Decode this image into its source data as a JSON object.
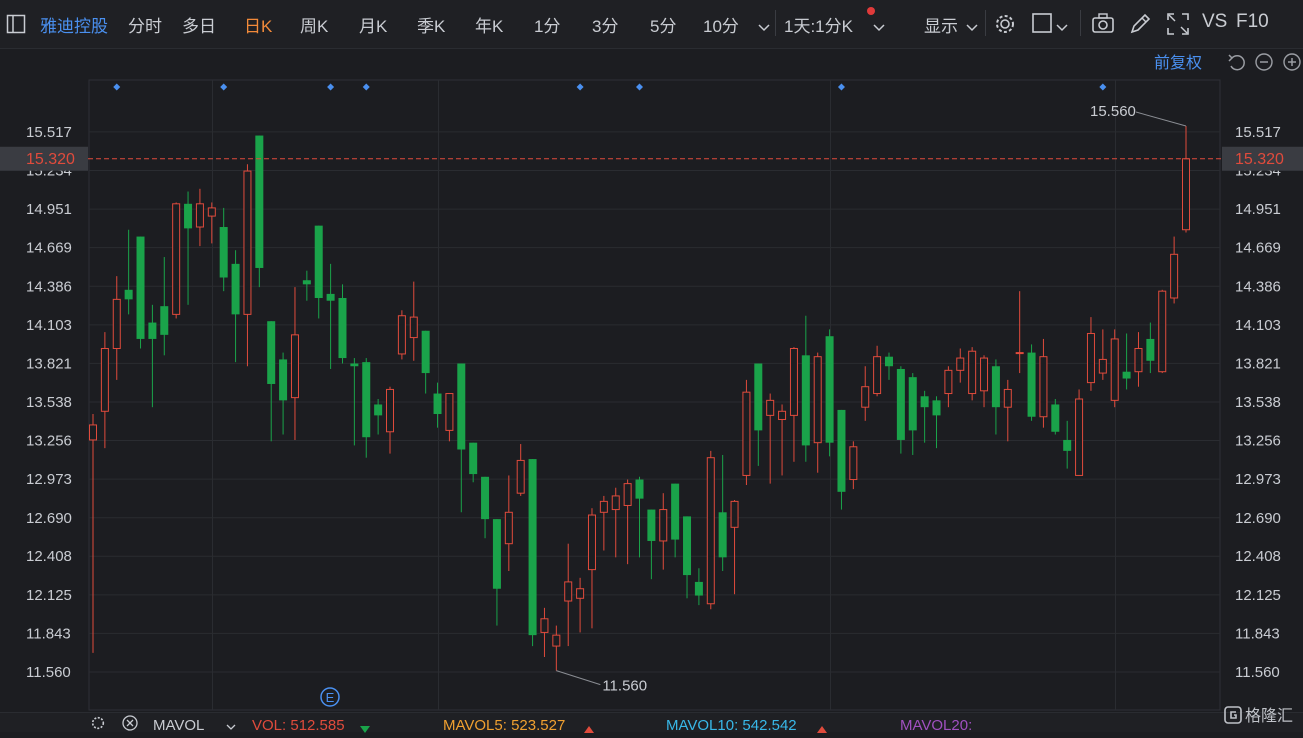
{
  "toolbar": {
    "stock_name": "雅迪控股",
    "periods": [
      "分时",
      "多日",
      "日K",
      "周K",
      "月K",
      "季K",
      "年K",
      "1分",
      "3分",
      "5分",
      "10分"
    ],
    "active_period": "日K",
    "multi_period": "1天:1分K",
    "display_label": "显示",
    "vs_label": "VS",
    "f10_label": "F10"
  },
  "chart_header": {
    "adjust_label": "前复权"
  },
  "price_axis": {
    "ticks": [
      "15.517",
      "15.234",
      "14.951",
      "14.669",
      "14.386",
      "14.103",
      "13.821",
      "13.538",
      "13.256",
      "12.973",
      "12.690",
      "12.408",
      "12.125",
      "11.843",
      "11.560"
    ],
    "current_price": "15.320",
    "current_price_color": "#e04b3c",
    "up_color": "#e04b3c",
    "down_color": "#1aa34a"
  },
  "annotations": {
    "high_label": "15.560",
    "low_label": "11.560",
    "event_marker": "E"
  },
  "volume_bar": {
    "mavol_label": "MAVOL",
    "vol_label": "VOL: 512.585",
    "mavol5_label": "MAVOL5: 523.527",
    "mavol10_label": "MAVOL10: 542.542",
    "mavol20_label": "MAVOL20:",
    "vol_color": "#e04b3c",
    "mavol5_color": "#f0a030",
    "mavol10_color": "#38b8e8",
    "mavol20_color": "#a050c0"
  },
  "watermark": "格隆汇",
  "chart_data": {
    "type": "candlestick",
    "ylim": [
      11.56,
      15.56
    ],
    "current_price": 15.32,
    "high": 15.56,
    "low": 11.56,
    "candles": [
      {
        "o": 13.26,
        "c": 13.37,
        "h": 13.45,
        "l": 11.7
      },
      {
        "o": 13.47,
        "c": 13.93,
        "h": 14.05,
        "l": 13.2
      },
      {
        "o": 13.93,
        "c": 14.29,
        "h": 14.46,
        "l": 13.7
      },
      {
        "o": 14.36,
        "c": 14.29,
        "h": 14.8,
        "l": 14.18
      },
      {
        "o": 14.75,
        "c": 14.0,
        "h": 14.75,
        "l": 13.93
      },
      {
        "o": 14.12,
        "c": 14.0,
        "h": 14.25,
        "l": 13.5
      },
      {
        "o": 14.24,
        "c": 14.03,
        "h": 14.6,
        "l": 13.88
      },
      {
        "o": 14.18,
        "c": 14.99,
        "h": 15.0,
        "l": 14.15
      },
      {
        "o": 14.99,
        "c": 14.81,
        "h": 15.08,
        "l": 14.25
      },
      {
        "o": 14.82,
        "c": 14.99,
        "h": 15.1,
        "l": 14.68
      },
      {
        "o": 14.9,
        "c": 14.96,
        "h": 15.0,
        "l": 14.7
      },
      {
        "o": 14.82,
        "c": 14.45,
        "h": 14.96,
        "l": 14.35
      },
      {
        "o": 14.55,
        "c": 14.18,
        "h": 14.65,
        "l": 13.83
      },
      {
        "o": 14.18,
        "c": 15.23,
        "h": 15.28,
        "l": 13.8
      },
      {
        "o": 15.49,
        "c": 14.52,
        "h": 15.49,
        "l": 14.38
      },
      {
        "o": 14.13,
        "c": 13.67,
        "h": 14.13,
        "l": 13.25
      },
      {
        "o": 13.85,
        "c": 13.55,
        "h": 13.9,
        "l": 13.3
      },
      {
        "o": 13.57,
        "c": 14.03,
        "h": 14.38,
        "l": 13.26
      },
      {
        "o": 14.43,
        "c": 14.4,
        "h": 14.5,
        "l": 14.28
      },
      {
        "o": 14.83,
        "c": 14.3,
        "h": 14.83,
        "l": 14.15
      },
      {
        "o": 14.33,
        "c": 14.28,
        "h": 14.55,
        "l": 13.78
      },
      {
        "o": 14.3,
        "c": 13.86,
        "h": 14.4,
        "l": 13.82
      },
      {
        "o": 13.82,
        "c": 13.8,
        "h": 13.86,
        "l": 13.22
      },
      {
        "o": 13.83,
        "c": 13.28,
        "h": 13.86,
        "l": 13.13
      },
      {
        "o": 13.52,
        "c": 13.44,
        "h": 13.56,
        "l": 13.3
      },
      {
        "o": 13.32,
        "c": 13.63,
        "h": 13.65,
        "l": 13.16
      },
      {
        "o": 13.89,
        "c": 14.17,
        "h": 14.21,
        "l": 13.85
      },
      {
        "o": 14.01,
        "c": 14.16,
        "h": 14.42,
        "l": 13.84
      },
      {
        "o": 14.06,
        "c": 13.75,
        "h": 14.06,
        "l": 13.6
      },
      {
        "o": 13.6,
        "c": 13.45,
        "h": 13.68,
        "l": 13.35
      },
      {
        "o": 13.33,
        "c": 13.6,
        "h": 13.6,
        "l": 13.25
      },
      {
        "o": 13.82,
        "c": 13.19,
        "h": 13.82,
        "l": 12.73
      },
      {
        "o": 13.24,
        "c": 13.01,
        "h": 13.24,
        "l": 12.95
      },
      {
        "o": 12.99,
        "c": 12.68,
        "h": 12.99,
        "l": 12.54
      },
      {
        "o": 12.68,
        "c": 12.17,
        "h": 12.68,
        "l": 11.9
      },
      {
        "o": 12.5,
        "c": 12.73,
        "h": 13.0,
        "l": 12.3
      },
      {
        "o": 12.87,
        "c": 13.11,
        "h": 13.23,
        "l": 12.85
      },
      {
        "o": 13.12,
        "c": 11.83,
        "h": 13.12,
        "l": 11.75
      },
      {
        "o": 11.85,
        "c": 11.95,
        "h": 12.03,
        "l": 11.67
      },
      {
        "o": 11.75,
        "c": 11.83,
        "h": 11.9,
        "l": 11.57
      },
      {
        "o": 12.08,
        "c": 12.22,
        "h": 12.5,
        "l": 11.75
      },
      {
        "o": 12.1,
        "c": 12.17,
        "h": 12.25,
        "l": 11.85
      },
      {
        "o": 12.31,
        "c": 12.71,
        "h": 12.76,
        "l": 11.88
      },
      {
        "o": 12.73,
        "c": 12.81,
        "h": 12.85,
        "l": 12.45
      },
      {
        "o": 12.75,
        "c": 12.85,
        "h": 12.91,
        "l": 12.4
      },
      {
        "o": 12.78,
        "c": 12.94,
        "h": 12.97,
        "l": 12.35
      },
      {
        "o": 12.97,
        "c": 12.83,
        "h": 12.99,
        "l": 12.4
      },
      {
        "o": 12.75,
        "c": 12.52,
        "h": 12.75,
        "l": 12.24
      },
      {
        "o": 12.52,
        "c": 12.75,
        "h": 12.87,
        "l": 12.31
      },
      {
        "o": 12.94,
        "c": 12.53,
        "h": 12.94,
        "l": 12.4
      },
      {
        "o": 12.7,
        "c": 12.27,
        "h": 12.7,
        "l": 12.1
      },
      {
        "o": 12.22,
        "c": 12.12,
        "h": 12.32,
        "l": 12.05
      },
      {
        "o": 12.06,
        "c": 13.13,
        "h": 13.18,
        "l": 12.02
      },
      {
        "o": 12.73,
        "c": 12.4,
        "h": 13.15,
        "l": 12.3
      },
      {
        "o": 12.62,
        "c": 12.81,
        "h": 12.82,
        "l": 12.13
      },
      {
        "o": 13.0,
        "c": 13.61,
        "h": 13.7,
        "l": 12.93
      },
      {
        "o": 13.82,
        "c": 13.33,
        "h": 13.82,
        "l": 13.07
      },
      {
        "o": 13.44,
        "c": 13.55,
        "h": 13.6,
        "l": 12.94
      },
      {
        "o": 13.41,
        "c": 13.47,
        "h": 13.52,
        "l": 13.0
      },
      {
        "o": 13.44,
        "c": 13.93,
        "h": 13.94,
        "l": 13.1
      },
      {
        "o": 13.88,
        "c": 13.22,
        "h": 14.17,
        "l": 13.1
      },
      {
        "o": 13.24,
        "c": 13.87,
        "h": 13.9,
        "l": 13.02
      },
      {
        "o": 14.02,
        "c": 13.24,
        "h": 14.07,
        "l": 13.14
      },
      {
        "o": 13.48,
        "c": 12.88,
        "h": 13.48,
        "l": 12.75
      },
      {
        "o": 12.97,
        "c": 13.21,
        "h": 13.25,
        "l": 12.9
      },
      {
        "o": 13.5,
        "c": 13.65,
        "h": 13.8,
        "l": 13.4
      },
      {
        "o": 13.6,
        "c": 13.87,
        "h": 13.95,
        "l": 13.58
      },
      {
        "o": 13.87,
        "c": 13.8,
        "h": 13.9,
        "l": 13.7
      },
      {
        "o": 13.78,
        "c": 13.26,
        "h": 13.8,
        "l": 13.16
      },
      {
        "o": 13.72,
        "c": 13.33,
        "h": 13.75,
        "l": 13.15
      },
      {
        "o": 13.58,
        "c": 13.5,
        "h": 13.62,
        "l": 13.24
      },
      {
        "o": 13.55,
        "c": 13.44,
        "h": 13.58,
        "l": 13.2
      },
      {
        "o": 13.6,
        "c": 13.77,
        "h": 13.8,
        "l": 13.5
      },
      {
        "o": 13.77,
        "c": 13.86,
        "h": 13.93,
        "l": 13.68
      },
      {
        "o": 13.6,
        "c": 13.91,
        "h": 13.94,
        "l": 13.55
      },
      {
        "o": 13.62,
        "c": 13.86,
        "h": 13.88,
        "l": 13.5
      },
      {
        "o": 13.8,
        "c": 13.5,
        "h": 13.85,
        "l": 13.3
      },
      {
        "o": 13.5,
        "c": 13.63,
        "h": 13.7,
        "l": 13.25
      },
      {
        "o": 13.9,
        "c": 13.9,
        "h": 14.35,
        "l": 13.75
      },
      {
        "o": 13.9,
        "c": 13.43,
        "h": 13.96,
        "l": 13.4
      },
      {
        "o": 13.43,
        "c": 13.87,
        "h": 14.0,
        "l": 13.35
      },
      {
        "o": 13.52,
        "c": 13.32,
        "h": 13.56,
        "l": 13.3
      },
      {
        "o": 13.26,
        "c": 13.18,
        "h": 13.4,
        "l": 13.05
      },
      {
        "o": 13.0,
        "c": 13.56,
        "h": 13.63,
        "l": 13.0
      },
      {
        "o": 13.68,
        "c": 14.04,
        "h": 14.16,
        "l": 13.62
      },
      {
        "o": 13.75,
        "c": 13.85,
        "h": 14.07,
        "l": 13.7
      },
      {
        "o": 13.55,
        "c": 14.0,
        "h": 14.07,
        "l": 13.5
      },
      {
        "o": 13.76,
        "c": 13.71,
        "h": 14.04,
        "l": 13.63
      },
      {
        "o": 13.76,
        "c": 13.93,
        "h": 14.05,
        "l": 13.65
      },
      {
        "o": 14.0,
        "c": 13.84,
        "h": 14.12,
        "l": 13.75
      },
      {
        "o": 13.76,
        "c": 14.35,
        "h": 14.36,
        "l": 13.75
      },
      {
        "o": 14.3,
        "c": 14.62,
        "h": 14.75,
        "l": 14.26
      },
      {
        "o": 14.8,
        "c": 15.32,
        "h": 15.56,
        "l": 14.78
      }
    ]
  }
}
